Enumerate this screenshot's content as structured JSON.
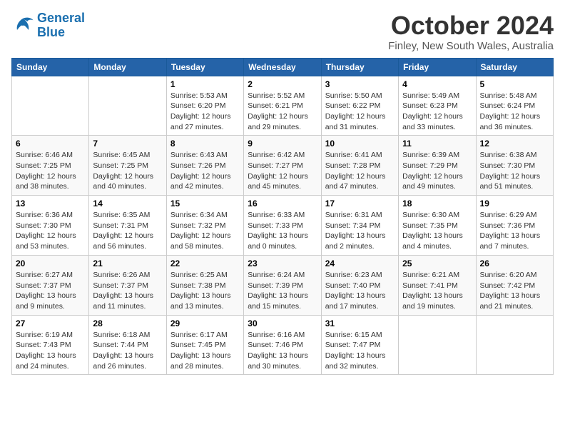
{
  "logo": {
    "line1": "General",
    "line2": "Blue"
  },
  "title": "October 2024",
  "location": "Finley, New South Wales, Australia",
  "days_of_week": [
    "Sunday",
    "Monday",
    "Tuesday",
    "Wednesday",
    "Thursday",
    "Friday",
    "Saturday"
  ],
  "weeks": [
    [
      {
        "num": "",
        "info": ""
      },
      {
        "num": "",
        "info": ""
      },
      {
        "num": "1",
        "info": "Sunrise: 5:53 AM\nSunset: 6:20 PM\nDaylight: 12 hours\nand 27 minutes."
      },
      {
        "num": "2",
        "info": "Sunrise: 5:52 AM\nSunset: 6:21 PM\nDaylight: 12 hours\nand 29 minutes."
      },
      {
        "num": "3",
        "info": "Sunrise: 5:50 AM\nSunset: 6:22 PM\nDaylight: 12 hours\nand 31 minutes."
      },
      {
        "num": "4",
        "info": "Sunrise: 5:49 AM\nSunset: 6:23 PM\nDaylight: 12 hours\nand 33 minutes."
      },
      {
        "num": "5",
        "info": "Sunrise: 5:48 AM\nSunset: 6:24 PM\nDaylight: 12 hours\nand 36 minutes."
      }
    ],
    [
      {
        "num": "6",
        "info": "Sunrise: 6:46 AM\nSunset: 7:25 PM\nDaylight: 12 hours\nand 38 minutes."
      },
      {
        "num": "7",
        "info": "Sunrise: 6:45 AM\nSunset: 7:25 PM\nDaylight: 12 hours\nand 40 minutes."
      },
      {
        "num": "8",
        "info": "Sunrise: 6:43 AM\nSunset: 7:26 PM\nDaylight: 12 hours\nand 42 minutes."
      },
      {
        "num": "9",
        "info": "Sunrise: 6:42 AM\nSunset: 7:27 PM\nDaylight: 12 hours\nand 45 minutes."
      },
      {
        "num": "10",
        "info": "Sunrise: 6:41 AM\nSunset: 7:28 PM\nDaylight: 12 hours\nand 47 minutes."
      },
      {
        "num": "11",
        "info": "Sunrise: 6:39 AM\nSunset: 7:29 PM\nDaylight: 12 hours\nand 49 minutes."
      },
      {
        "num": "12",
        "info": "Sunrise: 6:38 AM\nSunset: 7:30 PM\nDaylight: 12 hours\nand 51 minutes."
      }
    ],
    [
      {
        "num": "13",
        "info": "Sunrise: 6:36 AM\nSunset: 7:30 PM\nDaylight: 12 hours\nand 53 minutes."
      },
      {
        "num": "14",
        "info": "Sunrise: 6:35 AM\nSunset: 7:31 PM\nDaylight: 12 hours\nand 56 minutes."
      },
      {
        "num": "15",
        "info": "Sunrise: 6:34 AM\nSunset: 7:32 PM\nDaylight: 12 hours\nand 58 minutes."
      },
      {
        "num": "16",
        "info": "Sunrise: 6:33 AM\nSunset: 7:33 PM\nDaylight: 13 hours\nand 0 minutes."
      },
      {
        "num": "17",
        "info": "Sunrise: 6:31 AM\nSunset: 7:34 PM\nDaylight: 13 hours\nand 2 minutes."
      },
      {
        "num": "18",
        "info": "Sunrise: 6:30 AM\nSunset: 7:35 PM\nDaylight: 13 hours\nand 4 minutes."
      },
      {
        "num": "19",
        "info": "Sunrise: 6:29 AM\nSunset: 7:36 PM\nDaylight: 13 hours\nand 7 minutes."
      }
    ],
    [
      {
        "num": "20",
        "info": "Sunrise: 6:27 AM\nSunset: 7:37 PM\nDaylight: 13 hours\nand 9 minutes."
      },
      {
        "num": "21",
        "info": "Sunrise: 6:26 AM\nSunset: 7:37 PM\nDaylight: 13 hours\nand 11 minutes."
      },
      {
        "num": "22",
        "info": "Sunrise: 6:25 AM\nSunset: 7:38 PM\nDaylight: 13 hours\nand 13 minutes."
      },
      {
        "num": "23",
        "info": "Sunrise: 6:24 AM\nSunset: 7:39 PM\nDaylight: 13 hours\nand 15 minutes."
      },
      {
        "num": "24",
        "info": "Sunrise: 6:23 AM\nSunset: 7:40 PM\nDaylight: 13 hours\nand 17 minutes."
      },
      {
        "num": "25",
        "info": "Sunrise: 6:21 AM\nSunset: 7:41 PM\nDaylight: 13 hours\nand 19 minutes."
      },
      {
        "num": "26",
        "info": "Sunrise: 6:20 AM\nSunset: 7:42 PM\nDaylight: 13 hours\nand 21 minutes."
      }
    ],
    [
      {
        "num": "27",
        "info": "Sunrise: 6:19 AM\nSunset: 7:43 PM\nDaylight: 13 hours\nand 24 minutes."
      },
      {
        "num": "28",
        "info": "Sunrise: 6:18 AM\nSunset: 7:44 PM\nDaylight: 13 hours\nand 26 minutes."
      },
      {
        "num": "29",
        "info": "Sunrise: 6:17 AM\nSunset: 7:45 PM\nDaylight: 13 hours\nand 28 minutes."
      },
      {
        "num": "30",
        "info": "Sunrise: 6:16 AM\nSunset: 7:46 PM\nDaylight: 13 hours\nand 30 minutes."
      },
      {
        "num": "31",
        "info": "Sunrise: 6:15 AM\nSunset: 7:47 PM\nDaylight: 13 hours\nand 32 minutes."
      },
      {
        "num": "",
        "info": ""
      },
      {
        "num": "",
        "info": ""
      }
    ]
  ]
}
